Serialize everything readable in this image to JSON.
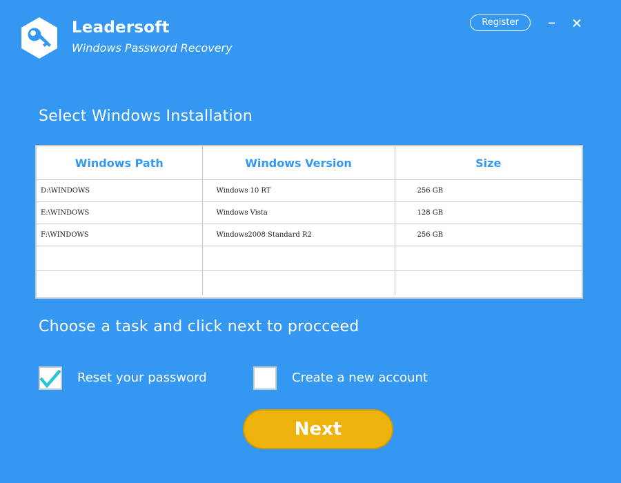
{
  "app": {
    "brand": "Leadersoft",
    "subtitle": "Windows Password Recovery"
  },
  "header": {
    "register_label": "Register",
    "minimize_icon": "minimize-icon",
    "close_icon": "close-icon",
    "logo_icon": "key-icon"
  },
  "install_section": {
    "title": "Select Windows Installation",
    "columns": [
      "Windows Path",
      "Windows Version",
      "Size"
    ],
    "rows": [
      {
        "path": "D:\\WINDOWS",
        "version": "Windows 10 RT",
        "size": "256 GB"
      },
      {
        "path": "E:\\WINDOWS",
        "version": "Windows Vista",
        "size": "128 GB"
      },
      {
        "path": "F:\\WINDOWS",
        "version": "Windows2008 Standard R2",
        "size": "256 GB"
      }
    ]
  },
  "task_section": {
    "title": "Choose a task and click next to procceed",
    "options": [
      {
        "label": "Reset your password",
        "checked": true
      },
      {
        "label": "Create a new account",
        "checked": false
      }
    ]
  },
  "next_label": "Next",
  "colors": {
    "background": "#3498f2",
    "accent_text": "#3498f2",
    "next_button": "#edb20c",
    "checkmark": "#2bc4d8",
    "border": "#c9c9c9"
  }
}
